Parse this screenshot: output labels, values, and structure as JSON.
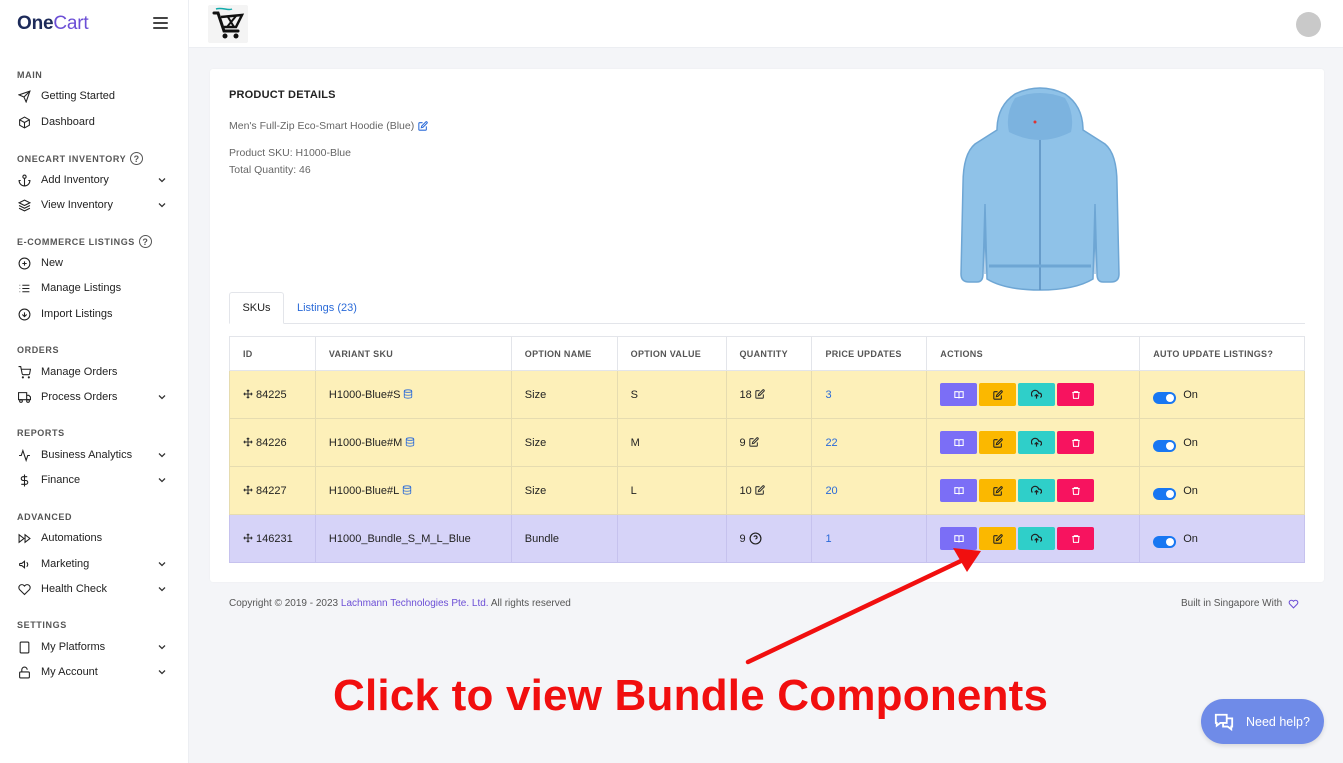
{
  "brand": {
    "one": "One",
    "cart": "Cart"
  },
  "sidebar": {
    "sections": [
      {
        "label": "MAIN"
      },
      {
        "label": "ONECART INVENTORY"
      },
      {
        "label": "E-COMMERCE LISTINGS"
      },
      {
        "label": "ORDERS"
      },
      {
        "label": "REPORTS"
      },
      {
        "label": "ADVANCED"
      },
      {
        "label": "SETTINGS"
      }
    ],
    "items": [
      {
        "label": "Getting Started",
        "icon": "send-icon"
      },
      {
        "label": "Dashboard",
        "icon": "cube-icon"
      },
      {
        "label": "Add Inventory",
        "icon": "anchor-icon",
        "has_dropdown": true
      },
      {
        "label": "View Inventory",
        "icon": "layers-icon",
        "has_dropdown": true
      },
      {
        "label": "New",
        "icon": "plus-circle-icon"
      },
      {
        "label": "Manage Listings",
        "icon": "list-icon"
      },
      {
        "label": "Import Listings",
        "icon": "download-circle-icon"
      },
      {
        "label": "Manage Orders",
        "icon": "cart-icon"
      },
      {
        "label": "Process Orders",
        "icon": "truck-icon",
        "has_dropdown": true
      },
      {
        "label": "Business Analytics",
        "icon": "activity-icon",
        "has_dropdown": true
      },
      {
        "label": "Finance",
        "icon": "dollar-icon",
        "has_dropdown": true
      },
      {
        "label": "Automations",
        "icon": "fast-forward-icon"
      },
      {
        "label": "Marketing",
        "icon": "megaphone-icon",
        "has_dropdown": true
      },
      {
        "label": "Health Check",
        "icon": "heart-icon",
        "has_dropdown": true
      },
      {
        "label": "My Platforms",
        "icon": "tablet-icon",
        "has_dropdown": true
      },
      {
        "label": "My Account",
        "icon": "lock-icon",
        "has_dropdown": true
      }
    ]
  },
  "product": {
    "title": "PRODUCT DETAILS",
    "name": "Men's Full-Zip Eco-Smart Hoodie (Blue)",
    "sku": "Product SKU: H1000-Blue",
    "total_quantity": "Total Quantity: 46"
  },
  "tabs": [
    {
      "label": "SKUs"
    },
    {
      "label": "Listings (23)"
    }
  ],
  "table": {
    "headers": [
      "ID",
      "VARIANT SKU",
      "OPTION NAME",
      "OPTION VALUE",
      "QUANTITY",
      "PRICE UPDATES",
      "ACTIONS",
      "AUTO UPDATE LISTINGS?"
    ],
    "rows": [
      {
        "id": "84225",
        "variant_sku": "H1000-Blue#S",
        "option_name": "Size",
        "option_value": "S",
        "quantity": "18",
        "price_updates": "3",
        "auto_update": "On"
      },
      {
        "id": "84226",
        "variant_sku": "H1000-Blue#M",
        "option_name": "Size",
        "option_value": "M",
        "quantity": "9",
        "price_updates": "22",
        "auto_update": "On"
      },
      {
        "id": "84227",
        "variant_sku": "H1000-Blue#L",
        "option_name": "Size",
        "option_value": "L",
        "quantity": "10",
        "price_updates": "20",
        "auto_update": "On"
      },
      {
        "id": "146231",
        "variant_sku": "H1000_Bundle_S_M_L_Blue",
        "option_name": "Bundle",
        "option_value": "",
        "quantity": "9",
        "price_updates": "1",
        "auto_update": "On"
      }
    ]
  },
  "footer": {
    "copyright_prefix": "Copyright © 2019 - 2023 ",
    "company": "Lachmann Technologies Pte. Ltd.",
    "copyright_suffix": " All rights reserved",
    "built": "Built in Singapore With"
  },
  "annotation": "Click to view Bundle Components",
  "help": {
    "label": "Need help?"
  },
  "colors": {
    "accent": "#6c4fd6",
    "link": "#2a6ad8",
    "row_yellow": "#fdf0b9",
    "row_purple": "#d6d3f8",
    "btn_view": "#7b6ef6",
    "btn_edit": "#fbb800",
    "btn_upload": "#2fcfc9",
    "btn_delete": "#f7135f",
    "annotation_red": "#f10f0f"
  }
}
